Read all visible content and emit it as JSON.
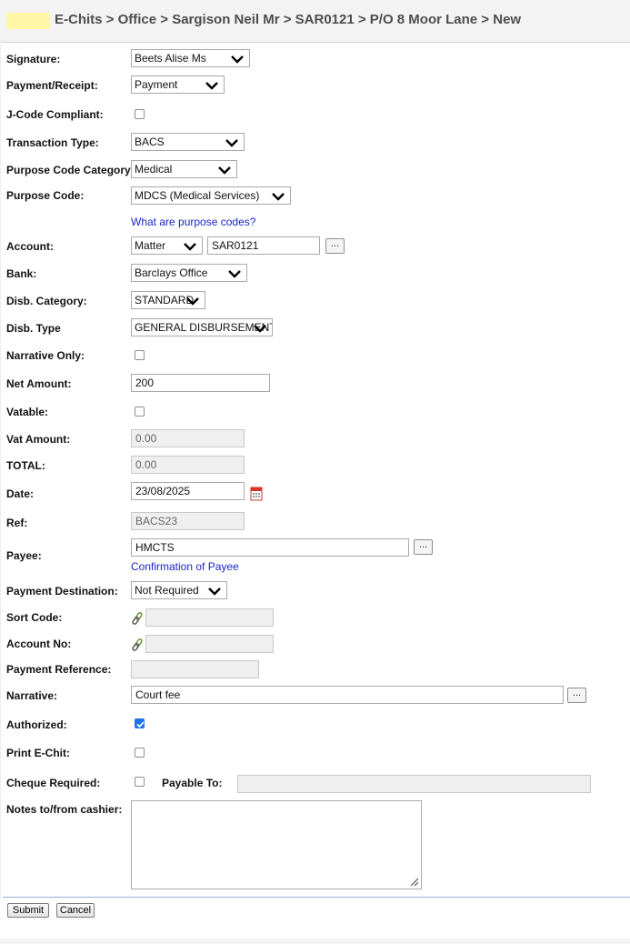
{
  "header": {
    "breadcrumb": "E-Chits > Office > Sargison Neil Mr > SAR0121 > P/O 8 Moor Lane > New"
  },
  "form": {
    "signature": {
      "label": "Signature:",
      "value": "Beets Alise Ms"
    },
    "payment_receipt": {
      "label": "Payment/Receipt:",
      "value": "Payment"
    },
    "jcode": {
      "label": "J-Code Compliant:",
      "checked": false
    },
    "transaction_type": {
      "label": "Transaction Type:",
      "value": "BACS"
    },
    "purpose_category": {
      "label": "Purpose Code Category:",
      "value": "Medical"
    },
    "purpose_code": {
      "label": "Purpose Code:",
      "value": "MDCS (Medical Services)",
      "help_link": "What are purpose codes?"
    },
    "account": {
      "label": "Account:",
      "type_value": "Matter",
      "code_value": "SAR0121",
      "lookup": "..."
    },
    "bank": {
      "label": "Bank:",
      "value": "Barclays Office"
    },
    "disb_category": {
      "label": "Disb. Category:",
      "value": "STANDARD"
    },
    "disb_type": {
      "label": "Disb. Type",
      "value": "GENERAL DISBURSEMENT"
    },
    "narrative_only": {
      "label": "Narrative Only:",
      "checked": false
    },
    "net_amount": {
      "label": "Net Amount:",
      "value": "200"
    },
    "vatable": {
      "label": "Vatable:",
      "checked": false
    },
    "vat_amount": {
      "label": "Vat Amount:",
      "value": "0.00"
    },
    "total": {
      "label": "TOTAL:",
      "value": "0.00"
    },
    "date": {
      "label": "Date:",
      "value": "23/08/2025"
    },
    "ref": {
      "label": "Ref:",
      "value": "BACS23"
    },
    "payee": {
      "label": "Payee:",
      "value": "HMCTS",
      "lookup": "...",
      "confirm_link": "Confirmation of Payee"
    },
    "payment_destination": {
      "label": "Payment Destination:",
      "value": "Not Required"
    },
    "sort_code": {
      "label": "Sort Code:",
      "value": ""
    },
    "account_no": {
      "label": "Account No:",
      "value": ""
    },
    "payment_reference": {
      "label": "Payment Reference:",
      "value": ""
    },
    "narrative": {
      "label": "Narrative:",
      "value": "Court fee",
      "lookup": "..."
    },
    "authorized": {
      "label": "Authorized:",
      "checked": true
    },
    "print_echit": {
      "label": "Print E-Chit:",
      "checked": false
    },
    "cheque_required": {
      "label": "Cheque Required:",
      "checked": false,
      "payable_label": "Payable To:",
      "payable_value": ""
    },
    "notes": {
      "label": "Notes to/from cashier:",
      "value": ""
    }
  },
  "actions": {
    "submit": "Submit",
    "cancel": "Cancel"
  }
}
